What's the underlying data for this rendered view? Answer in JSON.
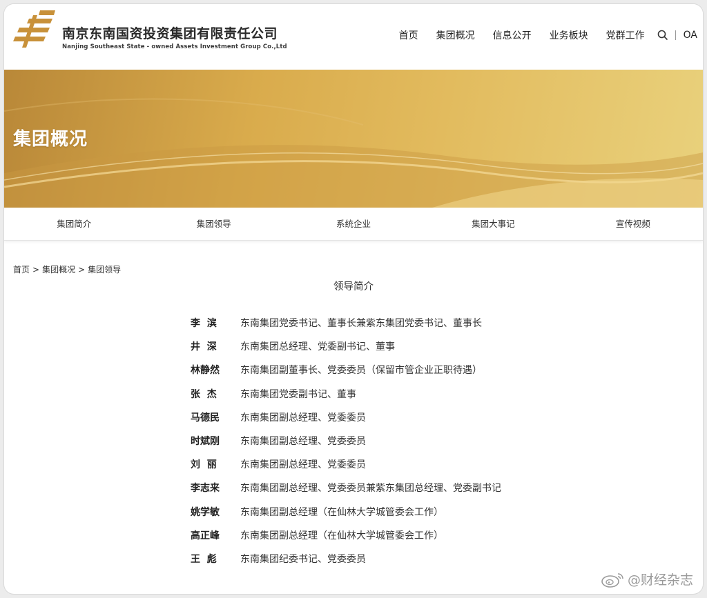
{
  "header": {
    "brand_cn": "南京东南国资投资集团有限责任公司",
    "brand_en": "Nanjing Southeast State - owned Assets Investment Group Co.,Ltd",
    "nav": [
      "首页",
      "集团概况",
      "信息公开",
      "业务板块",
      "党群工作"
    ],
    "oa_label": "OA",
    "icons": {
      "logo": "company-logo-icon",
      "search": "search-icon"
    }
  },
  "banner": {
    "title": "集团概况"
  },
  "subnav": [
    "集团简介",
    "集团领导",
    "系统企业",
    "集团大事记",
    "宣传视频"
  ],
  "breadcrumb": [
    "首页",
    "集团概况",
    "集团领导"
  ],
  "breadcrumb_sep": ">",
  "section_title": "领导简介",
  "leaders": [
    {
      "name": "李  滨",
      "title": "东南集团党委书记、董事长兼紫东集团党委书记、董事长"
    },
    {
      "name": "井  深",
      "title": "东南集团总经理、党委副书记、董事"
    },
    {
      "name": "林静然",
      "title": " 东南集团副董事长、党委委员（保留市管企业正职待遇）"
    },
    {
      "name": "张  杰",
      "title": "东南集团党委副书记、董事"
    },
    {
      "name": "马德民",
      "title": "东南集团副总经理、党委委员"
    },
    {
      "name": "时斌刚",
      "title": "东南集团副总经理、党委委员"
    },
    {
      "name": "刘  丽",
      "title": "东南集团副总经理、党委委员"
    },
    {
      "name": "李志来",
      "title": "东南集团副总经理、党委委员兼紫东集团总经理、党委副书记"
    },
    {
      "name": "姚学敏",
      "title": "东南集团副总经理（在仙林大学城管委会工作）"
    },
    {
      "name": "高正峰",
      "title": "东南集团副总经理（在仙林大学城管委会工作）"
    },
    {
      "name": "王  彪",
      "title": "东南集团纪委书记、党委委员"
    }
  ],
  "watermark": {
    "text": "@财经杂志",
    "icon": "weibo-icon"
  },
  "colors": {
    "gold": "#d9ab4c",
    "logo_gold": "#c8913a"
  }
}
